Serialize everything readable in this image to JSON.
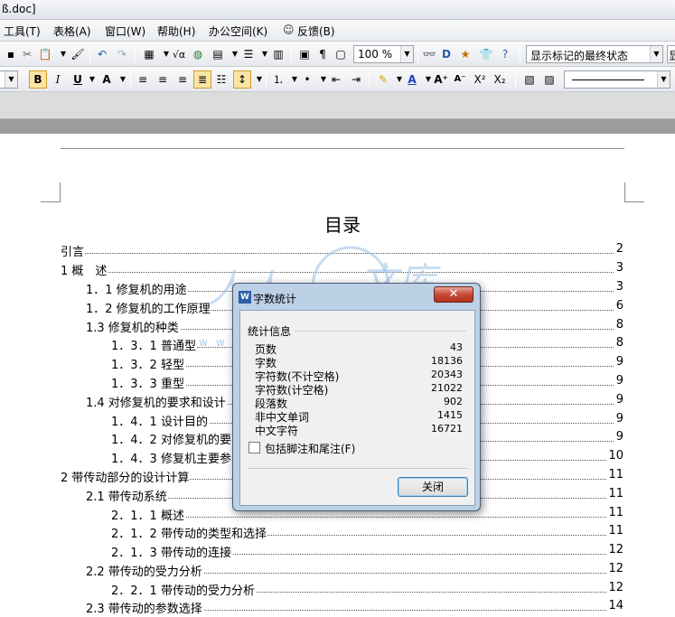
{
  "window": {
    "title": "ß.doc]"
  },
  "menubar": {
    "items": [
      "工具(T)",
      "表格(A)",
      "窗口(W)",
      "帮助(H)",
      "办公空间(K)",
      "反馈(B)"
    ]
  },
  "toolbar": {
    "zoom": "100 %",
    "markup_state": "显示标记的最终状态",
    "display_cut": "显"
  },
  "document": {
    "toc_title": "目录",
    "toc": [
      {
        "label": "引言",
        "page": "2"
      },
      {
        "label": "1 概　述",
        "page": "3"
      },
      {
        "label": "1．1 修复机的用途",
        "page": "3"
      },
      {
        "label": "1．2 修复机的工作原理",
        "page": "6"
      },
      {
        "label": "1.3 修复机的种类",
        "page": "8"
      },
      {
        "label": "1．3．1 普通型",
        "page": "8"
      },
      {
        "label": "1．3．2 轻型",
        "page": "9"
      },
      {
        "label": "1．3．3 重型",
        "page": "9"
      },
      {
        "label": "1.4 对修复机的要求和设计",
        "page": "9"
      },
      {
        "label": "1．4．1 设计目的",
        "page": "9"
      },
      {
        "label": "1．4．2 对修复机的要",
        "page": "9"
      },
      {
        "label": "1．4．3 修复机主要参",
        "page": "10"
      },
      {
        "label": "2 带传动部分的设计计算",
        "page": "11"
      },
      {
        "label": "2.1 带传动系统",
        "page": "11"
      },
      {
        "label": "2．1．1 概述",
        "page": "11"
      },
      {
        "label": "2．1．2  带传动的类型和选择",
        "page": "11"
      },
      {
        "label": "2．1．3 带传动的连接",
        "page": "12"
      },
      {
        "label": "2.2 带传动的受力分析",
        "page": "12"
      },
      {
        "label": "2．2．1 带传动的受力分析",
        "page": "12"
      },
      {
        "label": "2.3 带传动的参数选择",
        "page": "14"
      }
    ]
  },
  "watermark": {
    "url_text": "www.renrendoc.com",
    "glyph_left": "人人",
    "glyph_right": "文库"
  },
  "dialog": {
    "title": "字数统计",
    "close_glyph": "✕",
    "group_title": "统计信息",
    "stats": [
      {
        "label": "页数",
        "value": "43"
      },
      {
        "label": "字数",
        "value": "18136"
      },
      {
        "label": "字符数(不计空格)",
        "value": "20343"
      },
      {
        "label": "字符数(计空格)",
        "value": "21022"
      },
      {
        "label": "段落数",
        "value": "902"
      },
      {
        "label": "非中文单词",
        "value": "1415"
      },
      {
        "label": "中文字符",
        "value": "16721"
      }
    ],
    "checkbox_label": "包括脚注和尾注(F)",
    "close_button": "关闭"
  },
  "colors": {
    "dialog_frame": "#bcd0e6",
    "close_red": "#c54a36",
    "watermark_blue": "#9cc3e6"
  }
}
